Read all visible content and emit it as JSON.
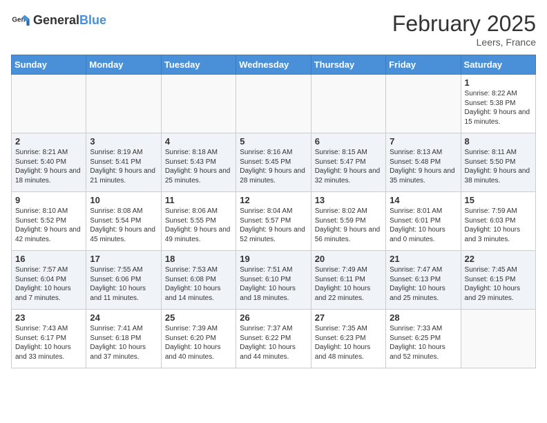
{
  "logo": {
    "text_general": "General",
    "text_blue": "Blue"
  },
  "title": "February 2025",
  "location": "Leers, France",
  "days_of_week": [
    "Sunday",
    "Monday",
    "Tuesday",
    "Wednesday",
    "Thursday",
    "Friday",
    "Saturday"
  ],
  "weeks": [
    [
      {
        "day": "",
        "info": ""
      },
      {
        "day": "",
        "info": ""
      },
      {
        "day": "",
        "info": ""
      },
      {
        "day": "",
        "info": ""
      },
      {
        "day": "",
        "info": ""
      },
      {
        "day": "",
        "info": ""
      },
      {
        "day": "1",
        "info": "Sunrise: 8:22 AM\nSunset: 5:38 PM\nDaylight: 9 hours and 15 minutes."
      }
    ],
    [
      {
        "day": "2",
        "info": "Sunrise: 8:21 AM\nSunset: 5:40 PM\nDaylight: 9 hours and 18 minutes."
      },
      {
        "day": "3",
        "info": "Sunrise: 8:19 AM\nSunset: 5:41 PM\nDaylight: 9 hours and 21 minutes."
      },
      {
        "day": "4",
        "info": "Sunrise: 8:18 AM\nSunset: 5:43 PM\nDaylight: 9 hours and 25 minutes."
      },
      {
        "day": "5",
        "info": "Sunrise: 8:16 AM\nSunset: 5:45 PM\nDaylight: 9 hours and 28 minutes."
      },
      {
        "day": "6",
        "info": "Sunrise: 8:15 AM\nSunset: 5:47 PM\nDaylight: 9 hours and 32 minutes."
      },
      {
        "day": "7",
        "info": "Sunrise: 8:13 AM\nSunset: 5:48 PM\nDaylight: 9 hours and 35 minutes."
      },
      {
        "day": "8",
        "info": "Sunrise: 8:11 AM\nSunset: 5:50 PM\nDaylight: 9 hours and 38 minutes."
      }
    ],
    [
      {
        "day": "9",
        "info": "Sunrise: 8:10 AM\nSunset: 5:52 PM\nDaylight: 9 hours and 42 minutes."
      },
      {
        "day": "10",
        "info": "Sunrise: 8:08 AM\nSunset: 5:54 PM\nDaylight: 9 hours and 45 minutes."
      },
      {
        "day": "11",
        "info": "Sunrise: 8:06 AM\nSunset: 5:55 PM\nDaylight: 9 hours and 49 minutes."
      },
      {
        "day": "12",
        "info": "Sunrise: 8:04 AM\nSunset: 5:57 PM\nDaylight: 9 hours and 52 minutes."
      },
      {
        "day": "13",
        "info": "Sunrise: 8:02 AM\nSunset: 5:59 PM\nDaylight: 9 hours and 56 minutes."
      },
      {
        "day": "14",
        "info": "Sunrise: 8:01 AM\nSunset: 6:01 PM\nDaylight: 10 hours and 0 minutes."
      },
      {
        "day": "15",
        "info": "Sunrise: 7:59 AM\nSunset: 6:03 PM\nDaylight: 10 hours and 3 minutes."
      }
    ],
    [
      {
        "day": "16",
        "info": "Sunrise: 7:57 AM\nSunset: 6:04 PM\nDaylight: 10 hours and 7 minutes."
      },
      {
        "day": "17",
        "info": "Sunrise: 7:55 AM\nSunset: 6:06 PM\nDaylight: 10 hours and 11 minutes."
      },
      {
        "day": "18",
        "info": "Sunrise: 7:53 AM\nSunset: 6:08 PM\nDaylight: 10 hours and 14 minutes."
      },
      {
        "day": "19",
        "info": "Sunrise: 7:51 AM\nSunset: 6:10 PM\nDaylight: 10 hours and 18 minutes."
      },
      {
        "day": "20",
        "info": "Sunrise: 7:49 AM\nSunset: 6:11 PM\nDaylight: 10 hours and 22 minutes."
      },
      {
        "day": "21",
        "info": "Sunrise: 7:47 AM\nSunset: 6:13 PM\nDaylight: 10 hours and 25 minutes."
      },
      {
        "day": "22",
        "info": "Sunrise: 7:45 AM\nSunset: 6:15 PM\nDaylight: 10 hours and 29 minutes."
      }
    ],
    [
      {
        "day": "23",
        "info": "Sunrise: 7:43 AM\nSunset: 6:17 PM\nDaylight: 10 hours and 33 minutes."
      },
      {
        "day": "24",
        "info": "Sunrise: 7:41 AM\nSunset: 6:18 PM\nDaylight: 10 hours and 37 minutes."
      },
      {
        "day": "25",
        "info": "Sunrise: 7:39 AM\nSunset: 6:20 PM\nDaylight: 10 hours and 40 minutes."
      },
      {
        "day": "26",
        "info": "Sunrise: 7:37 AM\nSunset: 6:22 PM\nDaylight: 10 hours and 44 minutes."
      },
      {
        "day": "27",
        "info": "Sunrise: 7:35 AM\nSunset: 6:23 PM\nDaylight: 10 hours and 48 minutes."
      },
      {
        "day": "28",
        "info": "Sunrise: 7:33 AM\nSunset: 6:25 PM\nDaylight: 10 hours and 52 minutes."
      },
      {
        "day": "",
        "info": ""
      }
    ]
  ]
}
